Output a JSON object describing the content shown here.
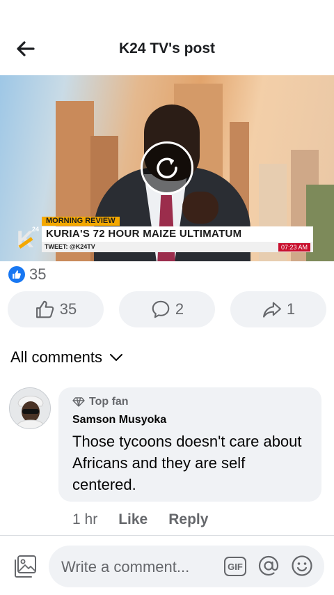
{
  "header": {
    "title": "K24 TV's post"
  },
  "video": {
    "show_tag": "MORNING REVIEW",
    "headline": "KURIA'S 72 HOUR MAIZE ULTIMATUM",
    "tweet": "TWEET: @K24TV",
    "time": "07:23 AM",
    "logo_letter": "K",
    "logo_sup": "24"
  },
  "reactions": {
    "count": "35"
  },
  "actions": {
    "like_count": "35",
    "comment_count": "2",
    "share_count": "1"
  },
  "comments_filter": {
    "label": "All comments"
  },
  "comment": {
    "badge": "Top fan",
    "author": "Samson Musyoka",
    "text": "Those tycoons doesn't care about Africans and they are self centered.",
    "time": "1 hr",
    "like_label": "Like",
    "reply_label": "Reply"
  },
  "composer": {
    "placeholder": "Write a comment...",
    "gif_label": "GIF"
  },
  "colors": {
    "accent": "#1877f2",
    "secondary_text": "#65676b",
    "pill_bg": "#f0f2f5",
    "k24_yellow": "#f4a800"
  }
}
